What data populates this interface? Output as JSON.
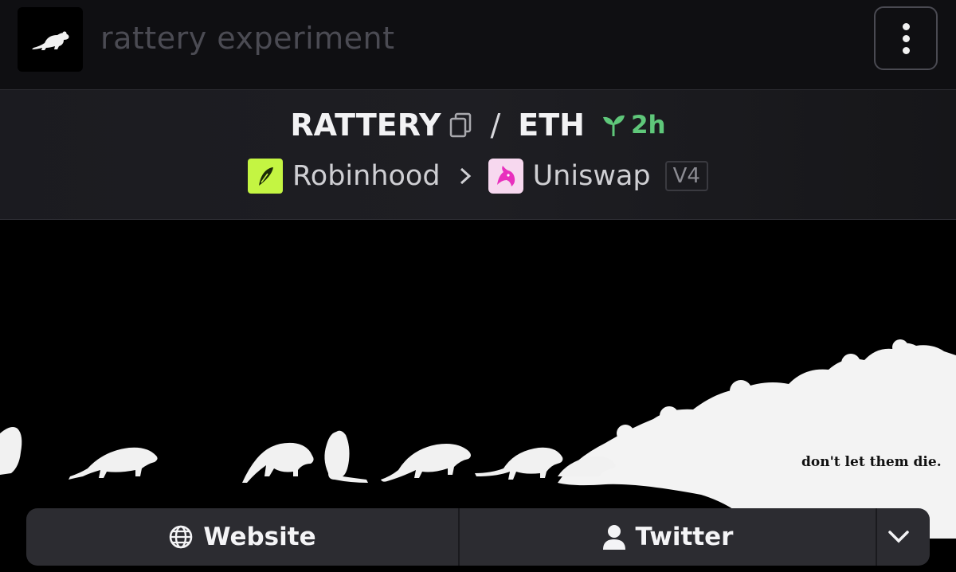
{
  "header": {
    "title": "rattery experiment",
    "logo_icon": "rat-icon",
    "menu_icon": "more-vertical-icon"
  },
  "pair": {
    "base": "RATTERY",
    "separator": "/",
    "quote": "ETH",
    "age": "2h",
    "age_color": "#5fc77a"
  },
  "route": {
    "chain": "Robinhood",
    "chain_color": "#c4f542",
    "dex": "Uniswap",
    "dex_color": "#f7d8ef",
    "version": "V4"
  },
  "banner": {
    "caption": "don't let them die."
  },
  "links": {
    "website_label": "Website",
    "twitter_label": "Twitter",
    "more_icon": "chevron-down-icon"
  }
}
